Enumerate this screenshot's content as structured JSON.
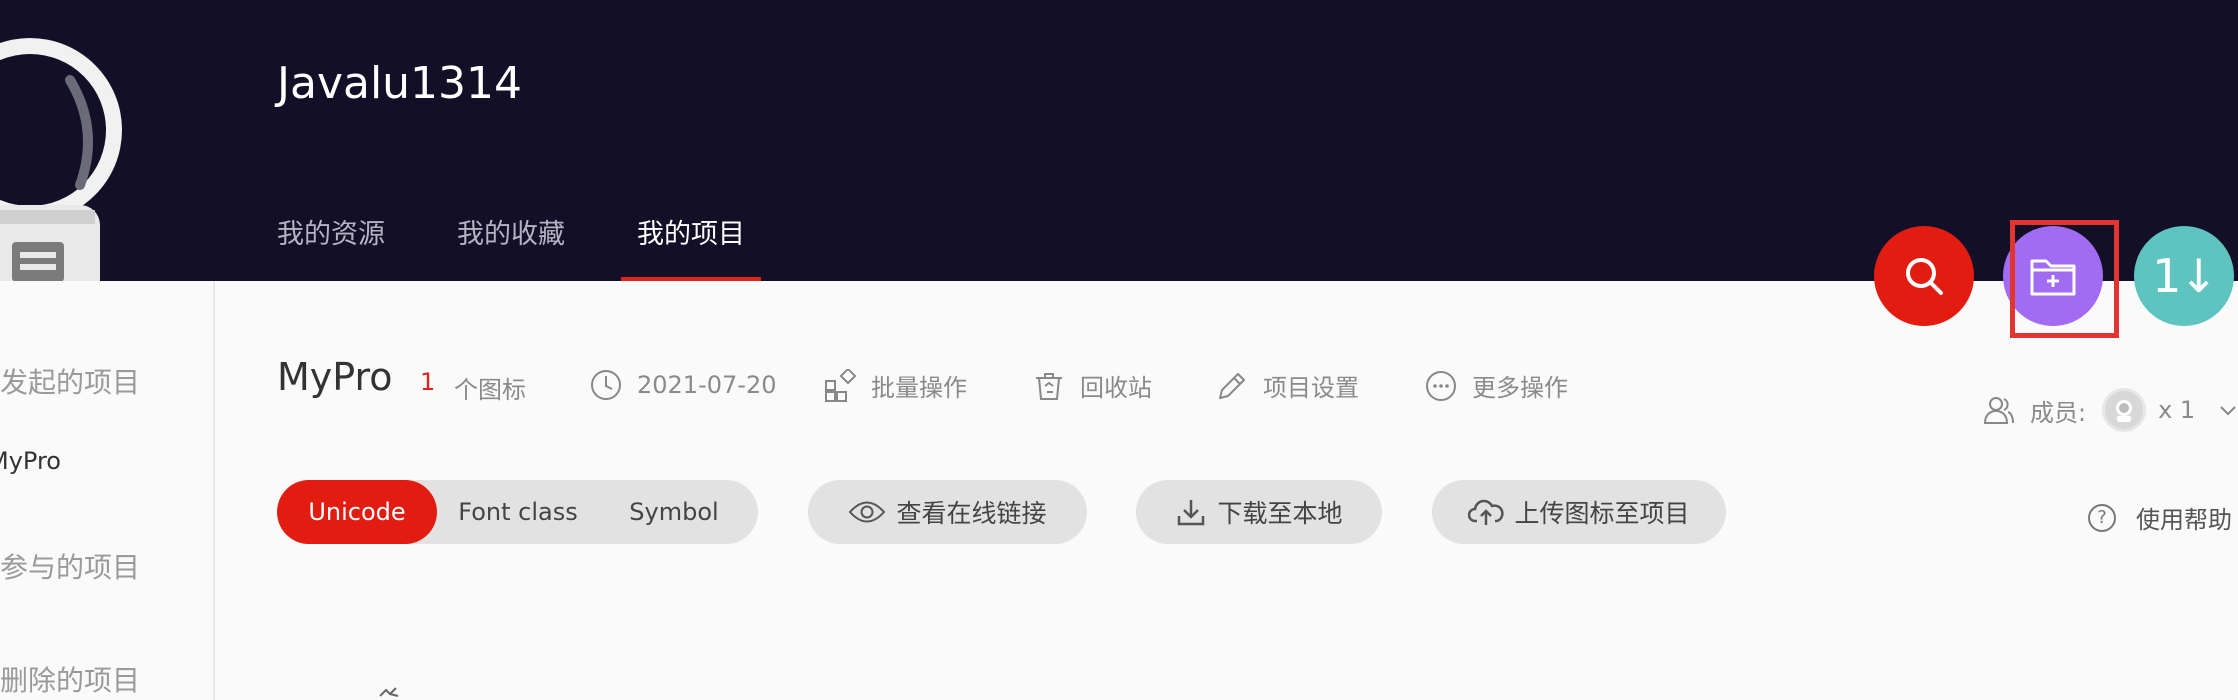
{
  "header": {
    "username": "Javalu1314",
    "tabs": [
      {
        "label": "我的资源"
      },
      {
        "label": "我的收藏"
      },
      {
        "label": "我的项目",
        "active": true
      }
    ],
    "bg_color": "#120f27"
  },
  "fabs": {
    "search_icon": "search-icon",
    "new_project_icon": "folder-plus-icon",
    "sort_label": "1↓"
  },
  "sidebar": {
    "items": [
      {
        "label": "我发起的项目"
      },
      {
        "label": "MyPro"
      },
      {
        "label": "我参与的项目"
      },
      {
        "label": "我删除的项目"
      }
    ]
  },
  "project": {
    "name": "MyPro",
    "icon_count": "1",
    "icon_count_label": "个图标",
    "date": "2021-07-20",
    "actions": {
      "batch": "批量操作",
      "recycle": "回收站",
      "settings": "项目设置",
      "more": "更多操作"
    },
    "members_label": "成员:",
    "members_count": "x 1"
  },
  "toolbar": {
    "formats": [
      "Unicode",
      "Font class",
      "Symbol"
    ],
    "active_format": "Unicode",
    "view_link": "查看在线链接",
    "download": "下载至本地",
    "upload": "上传图标至项目",
    "help": "使用帮助"
  },
  "colors": {
    "accent": "#e21c10",
    "purple": "#a16cf2",
    "teal": "#5fc3c0"
  }
}
